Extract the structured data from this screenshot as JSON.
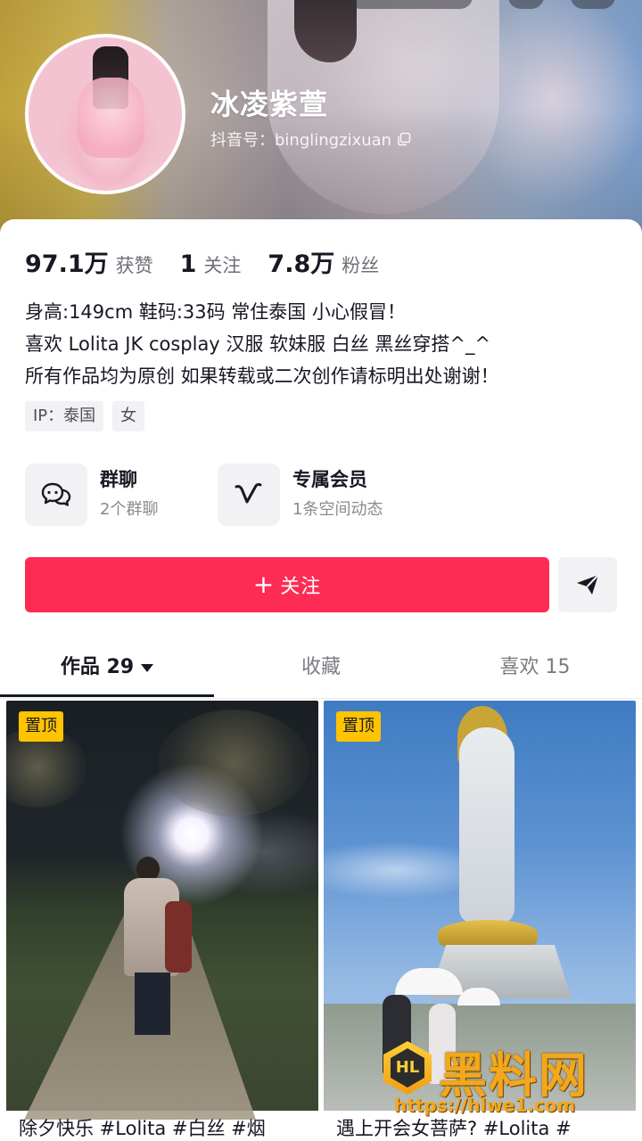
{
  "profile": {
    "name": "冰凌紫萱",
    "douyin_id": "抖音号：binglingzixuan"
  },
  "stats": [
    {
      "value": "97.1万",
      "label": "获赞"
    },
    {
      "value": "1",
      "label": "关注"
    },
    {
      "value": "7.8万",
      "label": "粉丝"
    }
  ],
  "bio": [
    "身高:149cm 鞋码:33码 常住泰国 小心假冒！",
    "喜欢 Lolita JK cosplay 汉服 软妹服 白丝 黑丝穿搭^_^",
    "所有作品均为原创 如果转载或二次创作请标明出处谢谢！"
  ],
  "tags": [
    "IP：泰国",
    "女"
  ],
  "features": [
    {
      "title": "群聊",
      "subtitle": "2个群聊",
      "icon": "chat-bubbles-icon"
    },
    {
      "title": "专属会员",
      "subtitle": "1条空间动态",
      "icon": "vip-v-icon"
    }
  ],
  "actions": {
    "follow_plus": "+",
    "follow_label": "关注",
    "share_icon": "send-icon"
  },
  "tabs": [
    {
      "label": "作品 29",
      "active": true
    },
    {
      "label": "收藏",
      "active": false
    },
    {
      "label": "喜欢 15",
      "active": false
    }
  ],
  "videos": [
    {
      "badge": "置顶",
      "caption": "除夕快乐 #Lolita #白丝 #烟"
    },
    {
      "badge": "置顶",
      "caption": "遇上开会女菩萨? #Lolita #"
    }
  ],
  "watermark": {
    "logo": "HL",
    "text": "黑料网",
    "url": "https://hlwe1.com"
  },
  "colors": {
    "accent": "#fe2c55",
    "badge": "#ffc300",
    "text": "#161823",
    "muted": "#6f7077"
  }
}
